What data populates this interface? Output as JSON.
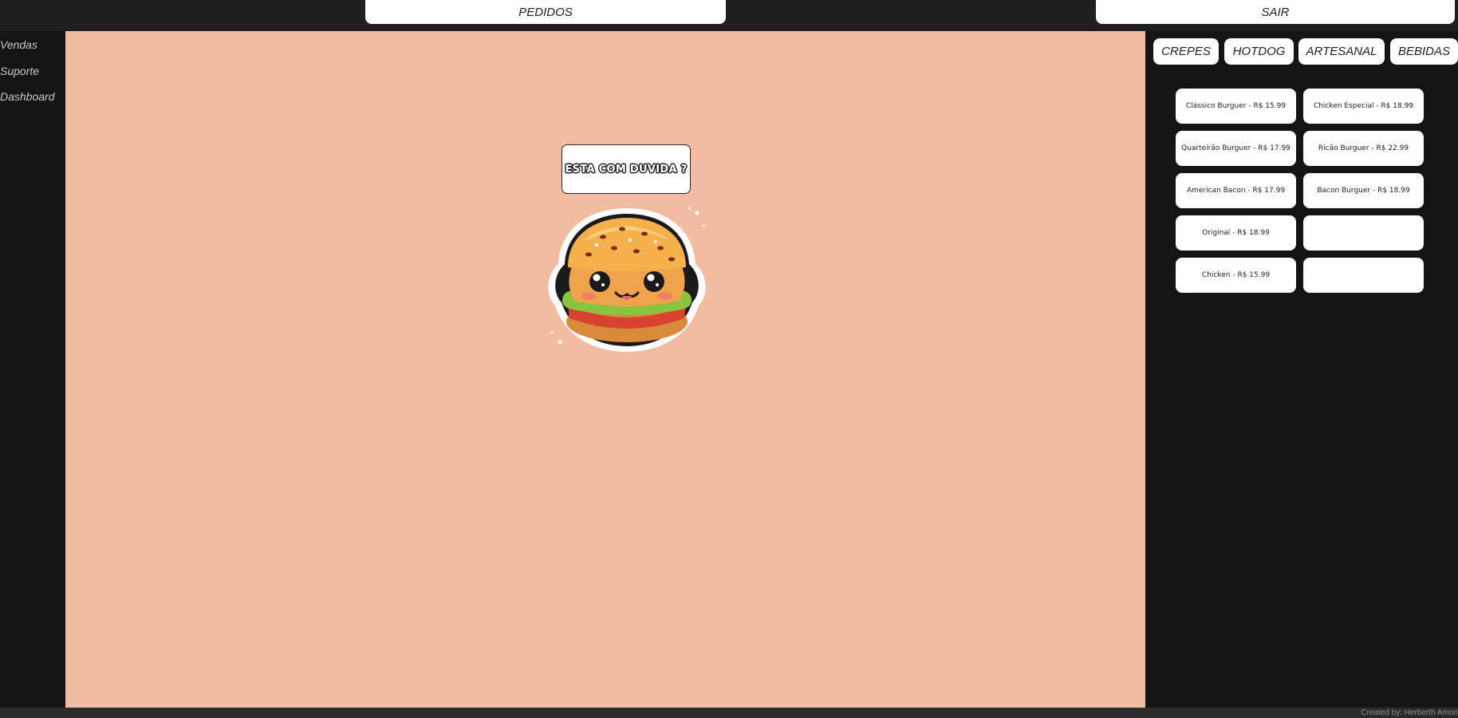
{
  "topbar": {
    "pedidos_label": "PEDIDOS",
    "sair_label": "SAIR"
  },
  "sidebar": {
    "items": [
      {
        "label": "Vendas"
      },
      {
        "label": "Suporte"
      },
      {
        "label": "Dashboard"
      }
    ]
  },
  "main": {
    "help_label": "ESTA COM DUVIDA ?",
    "mascot_icon": "burger-mascot-icon"
  },
  "categories": [
    {
      "label": "CREPES"
    },
    {
      "label": "HOTDOG"
    },
    {
      "label": "ARTESANAL"
    },
    {
      "label": "BEBIDAS"
    }
  ],
  "menu_items": [
    {
      "label": "Clássico Burguer - R$ 15.99"
    },
    {
      "label": "Chicken Especial - R$ 18.99"
    },
    {
      "label": "Quarteirão Burguer - R$ 17.99"
    },
    {
      "label": "Ricão Burguer - R$ 22.99"
    },
    {
      "label": "American Bacon - R$ 17.99"
    },
    {
      "label": "Bacon Burguer - R$ 18.99"
    },
    {
      "label": "Original - R$ 18.99"
    },
    {
      "label": ""
    },
    {
      "label": "Chicken - R$ 15.99"
    },
    {
      "label": ""
    }
  ],
  "footer": {
    "credit": "Created by: Herberth Amori"
  },
  "colors": {
    "main_bg": "#f2bca2",
    "dark_bg": "#141414",
    "topbar_bg": "#1f1f1f"
  }
}
